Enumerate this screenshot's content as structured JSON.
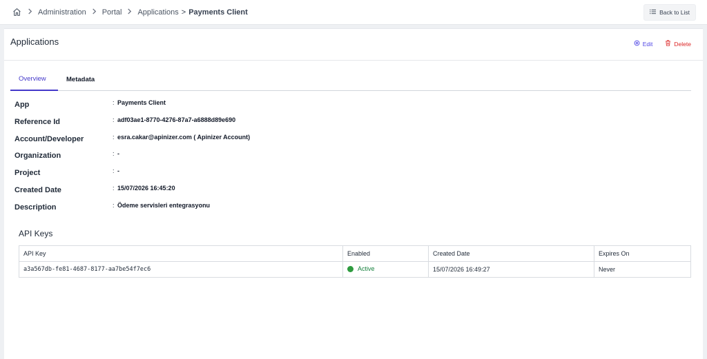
{
  "breadcrumb": {
    "items": [
      {
        "label": "Administration"
      },
      {
        "label": "Portal"
      },
      {
        "label": "Applications"
      }
    ],
    "gt": ">",
    "current": "Payments Client"
  },
  "header": {
    "back_label": "Back to List"
  },
  "page": {
    "title": "Applications",
    "edit_label": "Edit",
    "delete_label": "Delete"
  },
  "tabs": [
    {
      "label": "Overview",
      "active": true
    },
    {
      "label": "Metadata",
      "active": false
    }
  ],
  "details": [
    {
      "label": "App",
      "value": "Payments Client"
    },
    {
      "label": "Reference Id",
      "value": "adf03ae1-8770-4276-87a7-a6888d89e690"
    },
    {
      "label": "Account/Developer",
      "value": "esra.cakar@apinizer.com ( Apinizer Account)"
    },
    {
      "label": "Organization",
      "value": "-"
    },
    {
      "label": "Project",
      "value": "-"
    },
    {
      "label": "Created Date",
      "value": "15/07/2026 16:45:20"
    },
    {
      "label": "Description",
      "value": "Ödeme servisleri entegrasyonu"
    }
  ],
  "colon": ":",
  "api_keys": {
    "title": "API Keys",
    "columns": [
      "API Key",
      "Enabled",
      "Created Date",
      "Expires On"
    ],
    "rows": [
      {
        "key": "a3a567db-fe81-4687-8177-aa7be54f7ec6",
        "enabled": "Active",
        "created": "15/07/2026 16:49:27",
        "expires": "Never"
      }
    ]
  },
  "colors": {
    "accent": "#4338ca",
    "danger": "#dc2626",
    "active": "#2e9b3f"
  },
  "icons": {
    "home": "home-icon",
    "list": "list-icon",
    "edit": "edit-icon",
    "delete": "trash-icon",
    "chevron": "chevron-right-icon"
  }
}
